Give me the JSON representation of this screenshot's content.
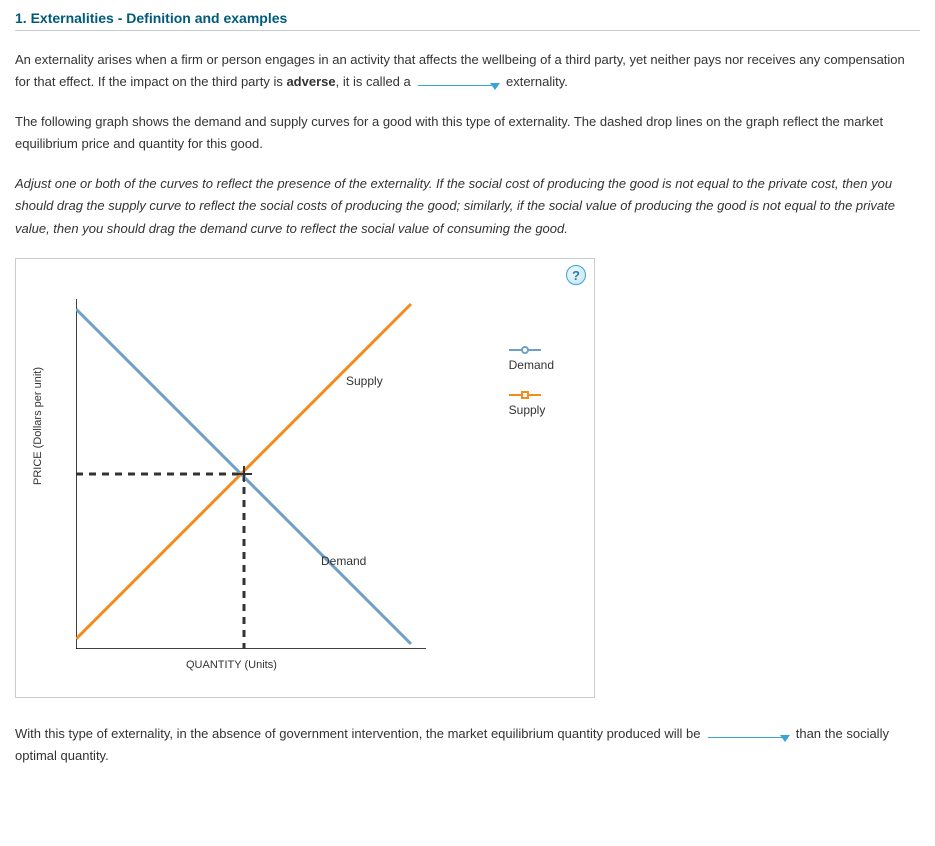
{
  "title": "1. Externalities - Definition and examples",
  "para1_pre": "An externality arises when a firm or person engages in an activity that affects the wellbeing of a third party, yet neither pays nor receives any compensation for that effect. If the impact on the third party is ",
  "para1_bold": "adverse",
  "para1_post": ", it is called a ",
  "para1_end": " externality.",
  "para2": "The following graph shows the demand and supply curves for a good with this type of externality. The dashed drop lines on the graph reflect the market equilibrium price and quantity for this good.",
  "para3": "Adjust one or both of the curves to reflect the presence of the externality. If the social cost of producing the good is not equal to the private cost, then you should drag the supply curve to reflect the social costs of producing the good; similarly, if the social value of producing the good is not equal to the private value, then you should drag the demand curve to reflect the social value of consuming the good.",
  "help": "?",
  "graph": {
    "ylabel": "PRICE (Dollars per unit)",
    "xlabel": "QUANTITY (Units)",
    "supply_label": "Supply",
    "demand_label": "Demand"
  },
  "legend": {
    "demand": "Demand",
    "supply": "Supply"
  },
  "para4_pre": "With this type of externality, in the absence of government intervention, the market equilibrium quantity produced will be ",
  "para4_post": " than the socially optimal quantity.",
  "chart_data": {
    "type": "line",
    "title": "",
    "xlabel": "QUANTITY (Units)",
    "ylabel": "PRICE (Dollars per unit)",
    "xlim": [
      0,
      10
    ],
    "ylim": [
      0,
      10
    ],
    "equilibrium": {
      "q": 5,
      "p": 5
    },
    "series": [
      {
        "name": "Demand",
        "color": "#6ea0c8",
        "points": [
          {
            "x": 0,
            "y": 10
          },
          {
            "x": 10,
            "y": 0
          }
        ]
      },
      {
        "name": "Supply",
        "color": "#f28c1f",
        "points": [
          {
            "x": 0,
            "y": 0
          },
          {
            "x": 10,
            "y": 10
          }
        ]
      }
    ],
    "drop_lines": [
      {
        "from": {
          "x": 0,
          "y": 5
        },
        "to": {
          "x": 5,
          "y": 5
        }
      },
      {
        "from": {
          "x": 5,
          "y": 5
        },
        "to": {
          "x": 5,
          "y": 0
        }
      }
    ]
  }
}
